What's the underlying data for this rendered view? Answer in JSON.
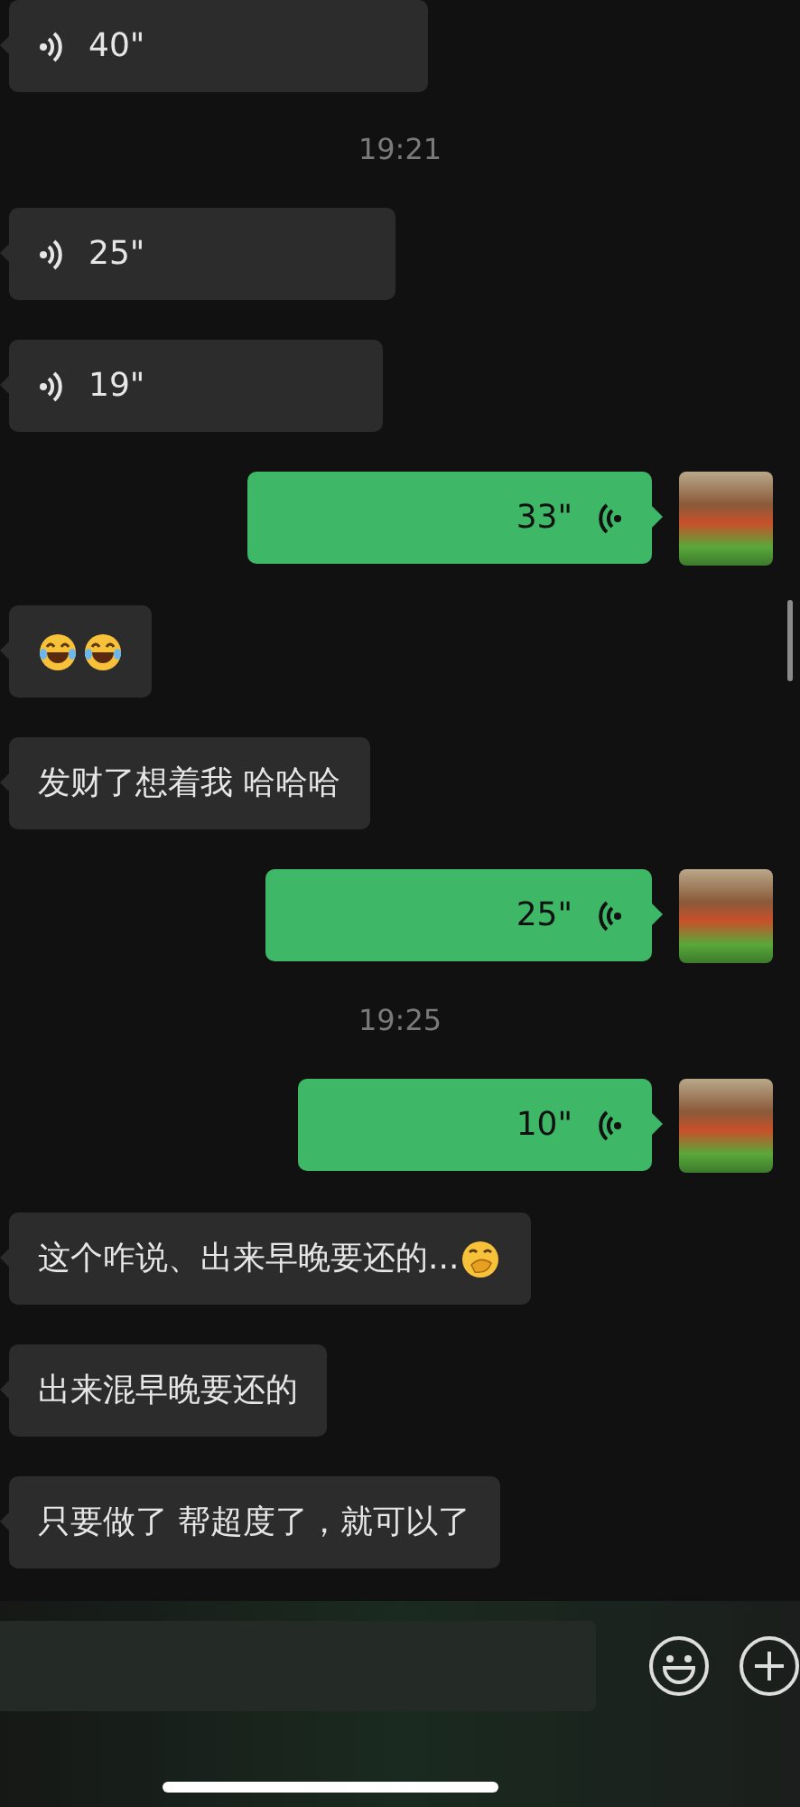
{
  "messages": [
    {
      "kind": "voice",
      "outgoing": false,
      "duration": "40\""
    },
    {
      "kind": "time",
      "text": "19:21"
    },
    {
      "kind": "voice",
      "outgoing": false,
      "duration": "25\""
    },
    {
      "kind": "voice",
      "outgoing": false,
      "duration": "19\""
    },
    {
      "kind": "voice",
      "outgoing": true,
      "duration": "33\""
    },
    {
      "kind": "emoji",
      "outgoing": false,
      "emojis": [
        {
          "kind": "laughing"
        },
        {
          "kind": "laughing"
        }
      ]
    },
    {
      "kind": "text",
      "outgoing": false,
      "text": "发财了想着我 哈哈哈"
    },
    {
      "kind": "voice",
      "outgoing": true,
      "duration": "25\""
    },
    {
      "kind": "time",
      "text": "19:25"
    },
    {
      "kind": "voice",
      "outgoing": true,
      "duration": "10\""
    },
    {
      "kind": "text",
      "outgoing": false,
      "text": "这个咋说、出来早晚要还的...",
      "trailing_emoji": {
        "kind": "hand-over-mouth"
      }
    },
    {
      "kind": "text",
      "outgoing": false,
      "text": "出来混早晚要还的"
    },
    {
      "kind": "text",
      "outgoing": false,
      "text": "只要做了 帮超度了，就可以了"
    }
  ]
}
